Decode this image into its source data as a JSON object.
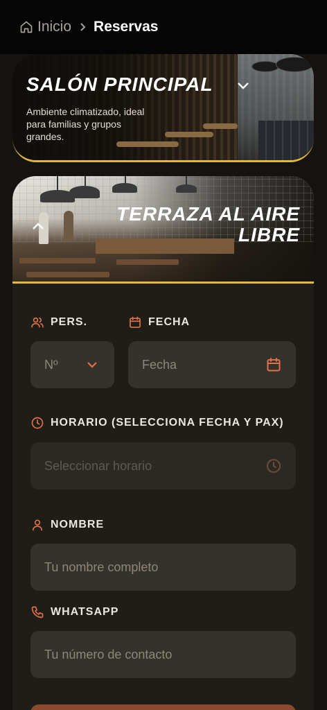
{
  "breadcrumb": {
    "home_label": "Inicio",
    "current_label": "Reservas"
  },
  "salon": {
    "title": "SALÓN PRINCIPAL",
    "description": "Ambiente climatizado, ideal para familias y grupos grandes."
  },
  "terraza": {
    "title": "TERRAZA AL AIRE LIBRE"
  },
  "form": {
    "pers_label": "PERS.",
    "pers_value": "Nº",
    "fecha_label": "FECHA",
    "fecha_placeholder": "Fecha",
    "horario_label": "HORARIO (SELECCIONA FECHA Y PAX)",
    "horario_placeholder": "Seleccionar horario",
    "nombre_label": "NOMBRE",
    "nombre_placeholder": "Tu nombre completo",
    "whatsapp_label": "WHATSAPP",
    "whatsapp_placeholder": "Tu número de contacto"
  },
  "colors": {
    "accent": "#e3b93a",
    "icon": "#e0714b",
    "button": "#8b4a2e"
  },
  "icons": [
    "home-icon",
    "chevron-right-icon",
    "chevron-down-icon",
    "chevron-up-icon",
    "users-icon",
    "calendar-icon",
    "clock-icon",
    "user-icon",
    "phone-icon"
  ]
}
